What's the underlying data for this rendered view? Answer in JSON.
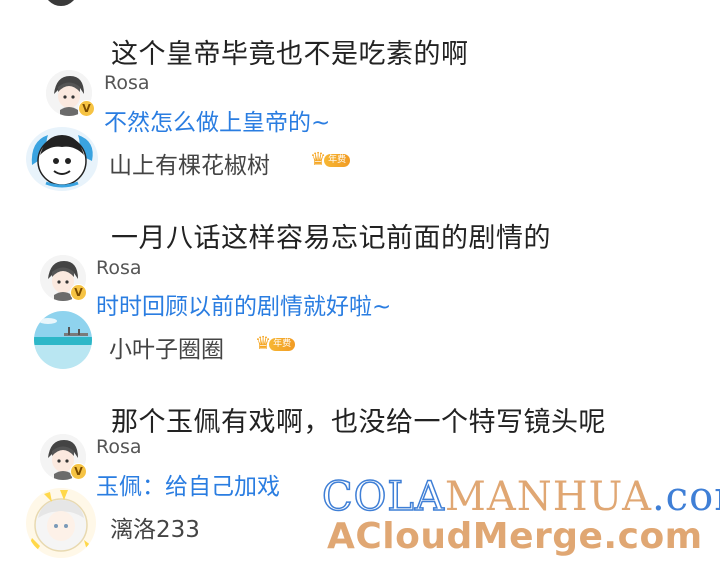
{
  "threads": [
    {
      "comment": "这个皇帝毕竟也不是吃素的啊",
      "reply_author": "Rosa",
      "reply_text": "不然怎么做上皇帝的~",
      "next_user": "山上有棵花椒树",
      "next_user_badge": "年费"
    },
    {
      "comment": "一月八话这样容易忘记前面的剧情的",
      "reply_author": "Rosa",
      "reply_text": "时时回顾以前的剧情就好啦~",
      "next_user": "小叶子圈圈",
      "next_user_badge": "年费"
    },
    {
      "comment": "那个玉佩有戏啊，也没给一个特写镜头呢",
      "reply_author": "Rosa",
      "reply_text": "玉佩：给自己加戏",
      "next_user": "漓洛233"
    }
  ],
  "verified_mark": "V",
  "watermark": {
    "line1_a": "COLA",
    "line1_b": "MANHUA",
    "line1_c": ".com",
    "line2": "ACloudMerge.com"
  },
  "colors": {
    "reply_text": "#2a7de1",
    "watermark_blue": "#3f7fd6",
    "watermark_orange": "#e0a773"
  }
}
